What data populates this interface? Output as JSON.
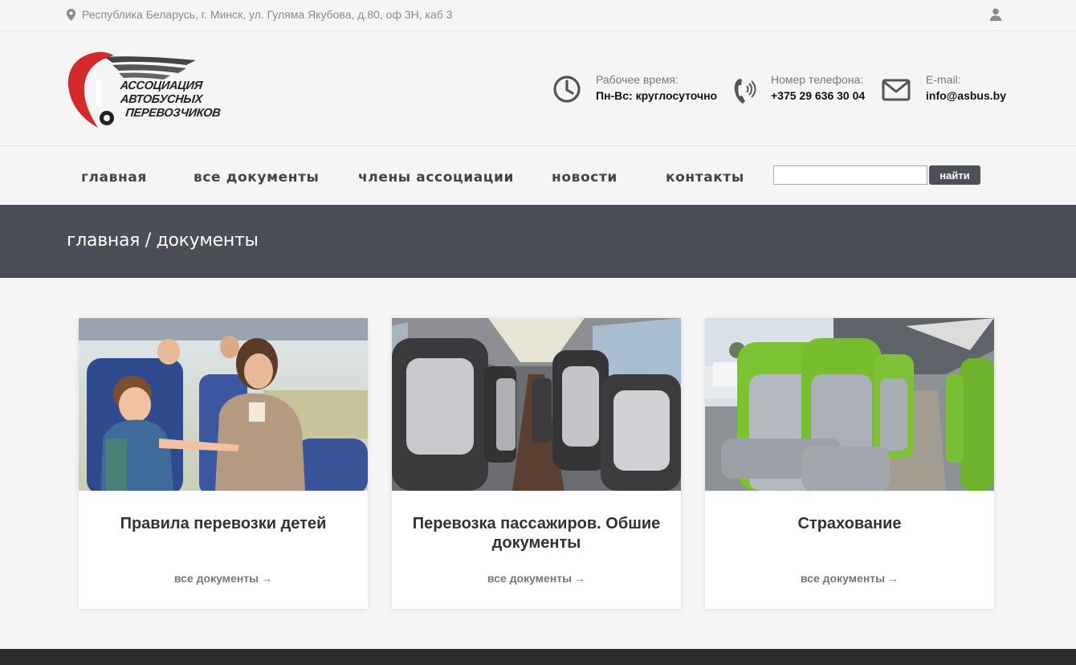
{
  "topbar": {
    "address": "Республика Беларусь, г. Минск, ул. Гуляма Якубова, д.80, оф 3Н, каб 3"
  },
  "header": {
    "logo_lines": [
      "АССОЦИАЦИЯ",
      "АВТОБУСНЫХ",
      "ПЕРЕВОЗЧИКОВ"
    ],
    "hours_label": "Рабочее время:",
    "hours_value": "Пн-Вс: круглосуточно",
    "phone_label": "Номер телефона:",
    "phone_value": "+375 29 636 30 04",
    "email_label": "E-mail:",
    "email_value": "info@asbus.by"
  },
  "nav": {
    "items": [
      {
        "label": "главная"
      },
      {
        "label": "все документы"
      },
      {
        "label": "члены ассоциации"
      },
      {
        "label": "новости"
      },
      {
        "label": "контакты"
      }
    ],
    "search_value": "",
    "search_button": "найти"
  },
  "titlebar": {
    "breadcrumb": "главная / документы"
  },
  "cards": [
    {
      "title": "Правила перевозки детей",
      "link": "все документы"
    },
    {
      "title": "Перевозка пассажиров. Обшие документы",
      "link": "все документы"
    },
    {
      "title": "Страхование",
      "link": "все документы"
    }
  ],
  "link_arrow": "→",
  "colors": {
    "background": "#f4f5f4",
    "titlebar": "#4b4d57",
    "button": "#4d5059",
    "logo_red": "#d42a2a",
    "footer": "#2b2c2e"
  }
}
